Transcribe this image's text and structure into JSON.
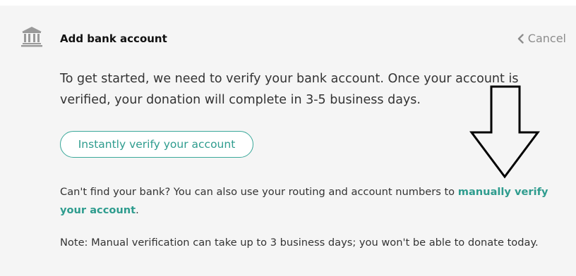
{
  "header": {
    "title": "Add bank account",
    "icon": "bank-icon",
    "cancel_label": "Cancel",
    "cancel_icon": "chevron-left-icon"
  },
  "intro": {
    "text": "To get started, we need to verify your bank account. Once your account is verified, your donation will complete in 3-5 business days."
  },
  "verify_button": {
    "label": "Instantly verify your account"
  },
  "help": {
    "text": "Can't find your bank? You can also use your routing and account numbers to ",
    "link_label": "manually verify your account",
    "suffix": "."
  },
  "note": {
    "text": "Note: Manual verification can take up to 3 business days; you won't be able to donate today."
  },
  "annotation": {
    "icon": "down-arrow-icon"
  },
  "colors": {
    "accent": "#2e9c8e",
    "background": "#f5f5f5",
    "muted": "#8c8c8c",
    "text": "#333333"
  }
}
